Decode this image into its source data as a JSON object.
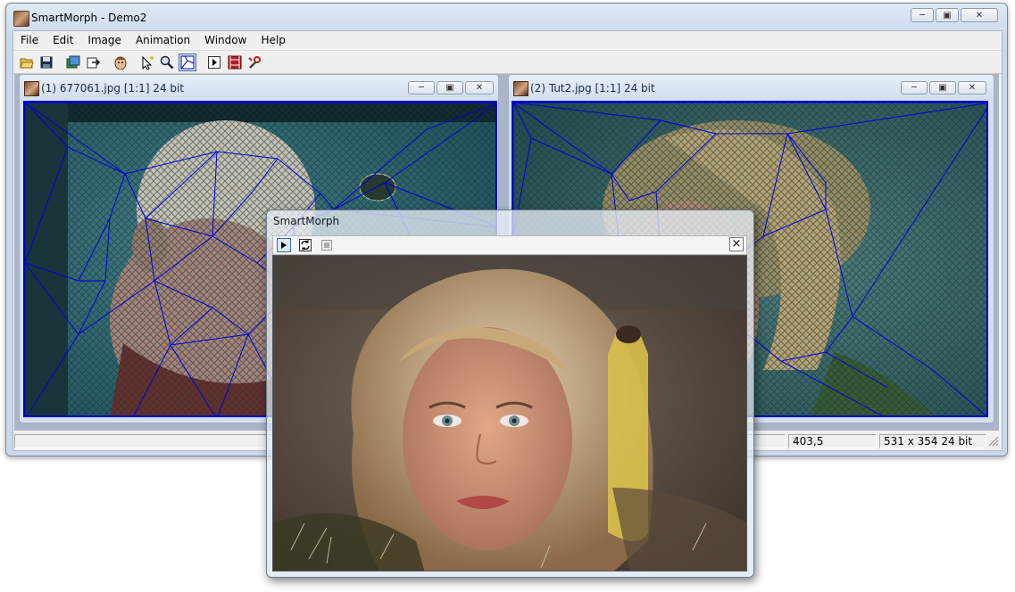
{
  "window": {
    "title": "SmartMorph - Demo2",
    "icon": "smartmorph-app-icon",
    "controls": [
      "minimize-icon",
      "maximize-icon",
      "close-icon"
    ]
  },
  "menu": [
    "File",
    "Edit",
    "Image",
    "Animation",
    "Window",
    "Help"
  ],
  "toolbar": {
    "buttons": [
      "open-icon",
      "save-icon",
      "load-images-icon",
      "export-icon",
      "face-icon",
      "pick-point-icon",
      "zoom-icon",
      "mesh-tool-icon",
      "play-icon",
      "frames-icon",
      "settings-icon"
    ]
  },
  "children": [
    {
      "title": "(1) 677061.jpg [1:1] 24 bit"
    },
    {
      "title": "(2) Tut2.jpg [1:1] 24 bit"
    }
  ],
  "status": {
    "left": "",
    "coords": "403,5",
    "dims": "531 x 354 24 bit"
  },
  "dialog": {
    "title": "SmartMorph",
    "controls": [
      "play-icon",
      "loop-icon",
      "stop-icon"
    ],
    "close": "×"
  },
  "colors": {
    "mesh": "#0000cc",
    "titlebar": "#dbe6f3"
  }
}
